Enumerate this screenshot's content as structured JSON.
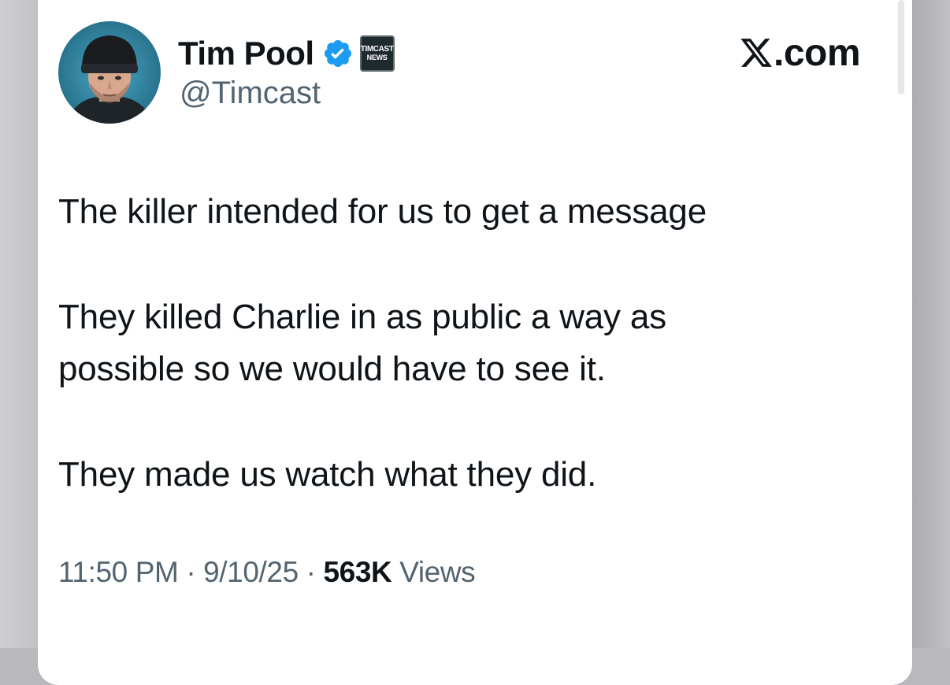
{
  "author": {
    "name": "Tim Pool",
    "handle": "@Timcast",
    "affiliate_badge_line1": "TIMCAST",
    "affiliate_badge_line2": "NEWS",
    "verified_color": "#1d9bf0"
  },
  "site": {
    "brand_text": ".com"
  },
  "tweet": {
    "line1": "The killer intended for us to get a message",
    "line2": "They killed Charlie in as public a way as",
    "line3": "possible so we would have to see it.",
    "line4": "They made us watch what they did."
  },
  "meta": {
    "time": "11:50 PM",
    "separator1": " · ",
    "date": "9/10/25",
    "separator2": " · ",
    "views_count": "563K",
    "views_label": " Views"
  },
  "icons": {
    "avatar": "avatar-photo",
    "verified": "verified-badge-icon",
    "x_logo": "x-logo-icon",
    "affiliate": "timcast-news-badge-icon"
  }
}
